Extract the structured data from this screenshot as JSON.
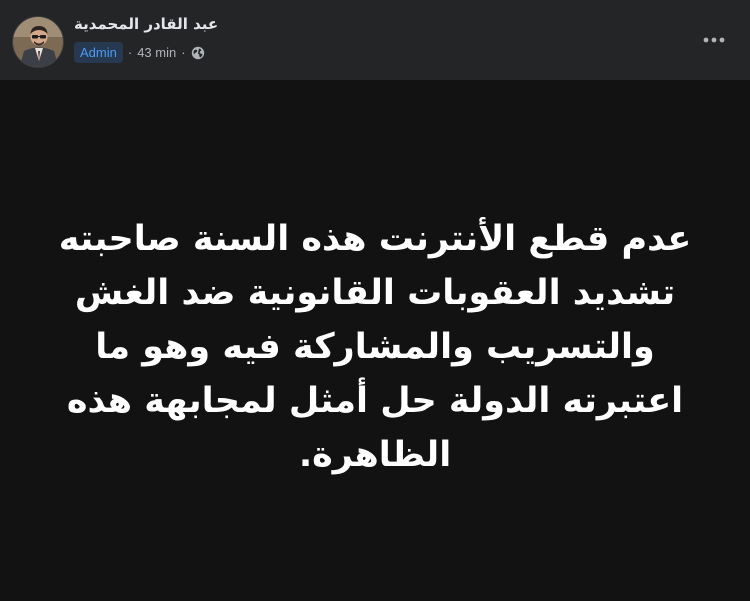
{
  "header": {
    "author_name": "عبد القادر المحمدية",
    "role_badge": "Admin",
    "separator": "·",
    "timestamp": "43 min",
    "audience_icon": "globe-icon",
    "more_icon": "more-horizontal-icon"
  },
  "post": {
    "text": "عدم قطع الأنترنت هذه السنة صاحبته تشديد العقوبات القانونية ضد الغش والتسريب والمشاركة فيه وهو ما اعتبرته الدولة حل أمثل لمجابهة هذه الظاهرة."
  },
  "colors": {
    "header_bg": "#242526",
    "body_bg": "#121212",
    "text": "#ffffff",
    "secondary_text": "#b0b3b8",
    "badge_bg": "#263951",
    "badge_text": "#4b9bf5"
  }
}
